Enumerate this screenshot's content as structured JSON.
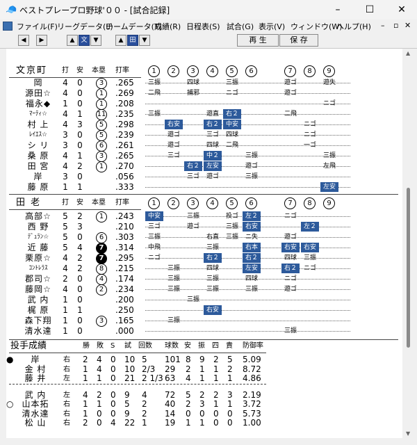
{
  "window": {
    "title": "ベストプレープロ野球'００ - [試合記録]",
    "min": "–",
    "max": "☐",
    "close": "✕"
  },
  "menu": [
    "ファイル(F)",
    "リーグデータ(L)",
    "チームデータ(T)",
    "成績(R)",
    "日程表(S)",
    "試合(G)",
    "表示(V)",
    "ウィンドウ(W)",
    "ヘルプ(H)"
  ],
  "menu_ctl": [
    "–",
    "▫",
    "✕"
  ],
  "toolbar": {
    "left_arrow": "◀",
    "right_arrow": "▶",
    "up1": "▲",
    "sel1": "文",
    "down1": "▼",
    "up2": "▲",
    "sel2": "田",
    "down2": "▼",
    "play": "再 生",
    "save": "保 存"
  },
  "innings": [
    "1",
    "2",
    "3",
    "4",
    "5",
    "6",
    "7",
    "8",
    "9"
  ],
  "hdr": {
    "ab": "打",
    "h": "安",
    "hr": "本塁",
    "avg": "打率"
  },
  "team1": {
    "name": "文京町",
    "rows": [
      {
        "name": "岡",
        "ab": "4",
        "h": "0",
        "hr": "3",
        "avg": ".265",
        "cells": [
          [
            "三振",
            ""
          ],
          [
            "",
            "四球"
          ],
          [
            "三振",
            ""
          ],
          [
            "",
            "遊ゴ"
          ],
          [
            "",
            "遊失"
          ]
        ]
      },
      {
        "name": "源田☆",
        "ab": "4",
        "h": "0",
        "hr": "1",
        "avg": ".269"
      },
      {
        "name": "福永◆",
        "ab": "1",
        "h": "0",
        "hr": "1",
        "avg": ".208"
      },
      {
        "name": "ﾏｰﾃｨ☆",
        "ab": "4",
        "h": "1",
        "hr": "11",
        "avg": ".235"
      },
      {
        "name": "村 上",
        "ab": "4",
        "h": "3",
        "hr": "5",
        "avg": ".298"
      },
      {
        "name": "ﾚｲｴｽ☆",
        "ab": "3",
        "h": "0",
        "hr": "5",
        "avg": ".239"
      },
      {
        "name": "シ リ",
        "ab": "3",
        "h": "0",
        "hr": "6",
        "avg": ".261"
      },
      {
        "name": "桑 原",
        "ab": "4",
        "h": "1",
        "hr": "3",
        "avg": ".265"
      },
      {
        "name": "田 宮",
        "ab": "4",
        "h": "2",
        "hr": "1",
        "avg": ".270"
      },
      {
        "name": "岸",
        "ab": "3",
        "h": "0",
        "hr": "",
        "avg": ".056"
      },
      {
        "name": "藤 原",
        "ab": "1",
        "h": "1",
        "hr": "",
        "avg": ".333"
      }
    ]
  },
  "team2": {
    "name": "田 老",
    "rows": [
      {
        "name": "高部☆",
        "ab": "5",
        "h": "2",
        "hr": "1",
        "avg": ".243"
      },
      {
        "name": "西 野",
        "ab": "5",
        "h": "3",
        "hr": "",
        "avg": ".210"
      },
      {
        "name": "ﾃﾞｭﾗﾝ☆",
        "ab": "5",
        "h": "0",
        "hr": "6",
        "avg": ".303"
      },
      {
        "name": "近 藤",
        "ab": "5",
        "h": "4",
        "hr": "7",
        "avg": ".314"
      },
      {
        "name": "栗原☆",
        "ab": "4",
        "h": "2",
        "hr": "7",
        "avg": ".295"
      },
      {
        "name": "ｺﾝﾄﾚﾗｽ",
        "ab": "4",
        "h": "2",
        "hr": "8",
        "avg": ".215"
      },
      {
        "name": "郡司☆",
        "ab": "2",
        "h": "0",
        "hr": "4",
        "avg": ".174"
      },
      {
        "name": "藤岡☆",
        "ab": "4",
        "h": "0",
        "hr": "2",
        "avg": ".234"
      },
      {
        "name": "武 内",
        "ab": "1",
        "h": "0",
        "hr": "",
        "avg": ".200"
      },
      {
        "name": "梶 原",
        "ab": "1",
        "h": "1",
        "hr": "",
        "avg": ".250"
      },
      {
        "name": "森下翔",
        "ab": "1",
        "h": "0",
        "hr": "3",
        "avg": ".165"
      },
      {
        "name": "清水達",
        "ab": "1",
        "h": "0",
        "hr": "",
        "avg": ".000"
      }
    ]
  },
  "pitch": {
    "title": "投手成績",
    "hdr": [
      "勝",
      "敗",
      "S",
      "試",
      "回数",
      "球数",
      "安",
      "振",
      "四",
      "責",
      "防御率"
    ],
    "rows": [
      [
        "●",
        "岸",
        "右",
        "2",
        "4",
        "0",
        "10",
        "5",
        "101",
        "8",
        "9",
        "2",
        "5",
        "5.09"
      ],
      [
        "",
        "金 村",
        "右",
        "1",
        "4",
        "0",
        "10",
        "2/3",
        "29",
        "2",
        "1",
        "1",
        "2",
        "8.72"
      ],
      [
        "",
        "藤 井",
        "左",
        "1",
        "1",
        "0",
        "21",
        "2 1/3",
        "63",
        "4",
        "1",
        "1",
        "1",
        "4.86"
      ],
      [
        "",
        "武 内",
        "左",
        "4",
        "2",
        "0",
        "9",
        "4",
        "72",
        "5",
        "2",
        "2",
        "3",
        "2.19"
      ],
      [
        "○",
        "山本拓",
        "右",
        "1",
        "1",
        "0",
        "5",
        "2",
        "40",
        "2",
        "3",
        "1",
        "1",
        "3.72"
      ],
      [
        "",
        "清水達",
        "右",
        "1",
        "0",
        "0",
        "9",
        "2",
        "14",
        "0",
        "0",
        "0",
        "0",
        "5.73"
      ],
      [
        "",
        "松 山",
        "右",
        "2",
        "0",
        "4",
        "22",
        "1",
        "19",
        "1",
        "1",
        "0",
        "0",
        "1.00"
      ]
    ]
  },
  "plays": {
    "t1": [
      [
        "三振",
        "",
        "四球",
        "",
        "三振",
        "",
        "遊ゴ",
        "",
        "遊失"
      ],
      [
        "二飛",
        "",
        "捕邪",
        "",
        "ニゴ",
        "",
        "遊ゴ",
        "",
        ""
      ],
      [
        "",
        "",
        "",
        "",
        "",
        "",
        "",
        "",
        "ニゴ"
      ],
      [
        "三振",
        "",
        "",
        "遊直",
        "右２",
        "",
        "二飛",
        "",
        ""
      ],
      [
        "",
        "右安",
        "",
        "右２",
        "中安",
        "",
        "",
        "ニゴ",
        ""
      ],
      [
        "",
        "遊ゴ",
        "",
        "三ゴ",
        "四球",
        "",
        "",
        "ニゴ",
        ""
      ],
      [
        "",
        "遊ゴ",
        "",
        "四球",
        "二飛",
        "",
        "",
        "一ゴ",
        ""
      ],
      [
        "",
        "三ゴ",
        "",
        "中２",
        "",
        "三振",
        "",
        "",
        "三振"
      ],
      [
        "",
        "",
        "右２",
        "左安",
        "",
        "遊ゴ",
        "",
        "",
        "左飛"
      ],
      [
        "",
        "",
        "三ゴ",
        "遊ゴ",
        "",
        "三振",
        "",
        "",
        ""
      ],
      [
        "",
        "",
        "",
        "",
        "",
        "",
        "",
        "",
        "左安"
      ]
    ],
    "t2": [
      [
        "中安",
        "",
        "三振",
        "",
        "投ゴ",
        "左２",
        "ニゴ",
        "",
        ""
      ],
      [
        "三ゴ",
        "",
        "遊ゴ",
        "",
        "三振",
        "右安",
        "",
        "左２",
        ""
      ],
      [
        "三振",
        "",
        "",
        "右直",
        "三振",
        "ニ失",
        "遊ゴ",
        "",
        ""
      ],
      [
        "中飛",
        "",
        "",
        "三振",
        "",
        "右本",
        "右安",
        "右安",
        ""
      ],
      [
        "ニゴ",
        "",
        "",
        "右２",
        "",
        "右２",
        "四球",
        "三振",
        ""
      ],
      [
        "",
        "三振",
        "",
        "四球",
        "",
        "左安",
        "右２",
        "ニゴ",
        ""
      ],
      [
        "",
        "三振",
        "",
        "三振",
        "",
        "四球",
        "ニゴ",
        "",
        ""
      ],
      [
        "",
        "三振",
        "",
        "三振",
        "",
        "三振",
        "遊ゴ",
        "",
        ""
      ],
      [
        "",
        "",
        "三振",
        "",
        "",
        "",
        "",
        "",
        ""
      ],
      [
        "",
        "",
        "",
        "右安",
        "",
        "",
        "",
        "",
        ""
      ],
      [
        "",
        "三振",
        "",
        "",
        "",
        "",
        "",
        "",
        ""
      ],
      [
        "",
        "",
        "",
        "",
        "",
        "",
        "三振",
        "",
        ""
      ]
    ],
    "hits": [
      "右安",
      "右２",
      "中安",
      "中２",
      "左安",
      "左２",
      "右本",
      "右安"
    ]
  }
}
